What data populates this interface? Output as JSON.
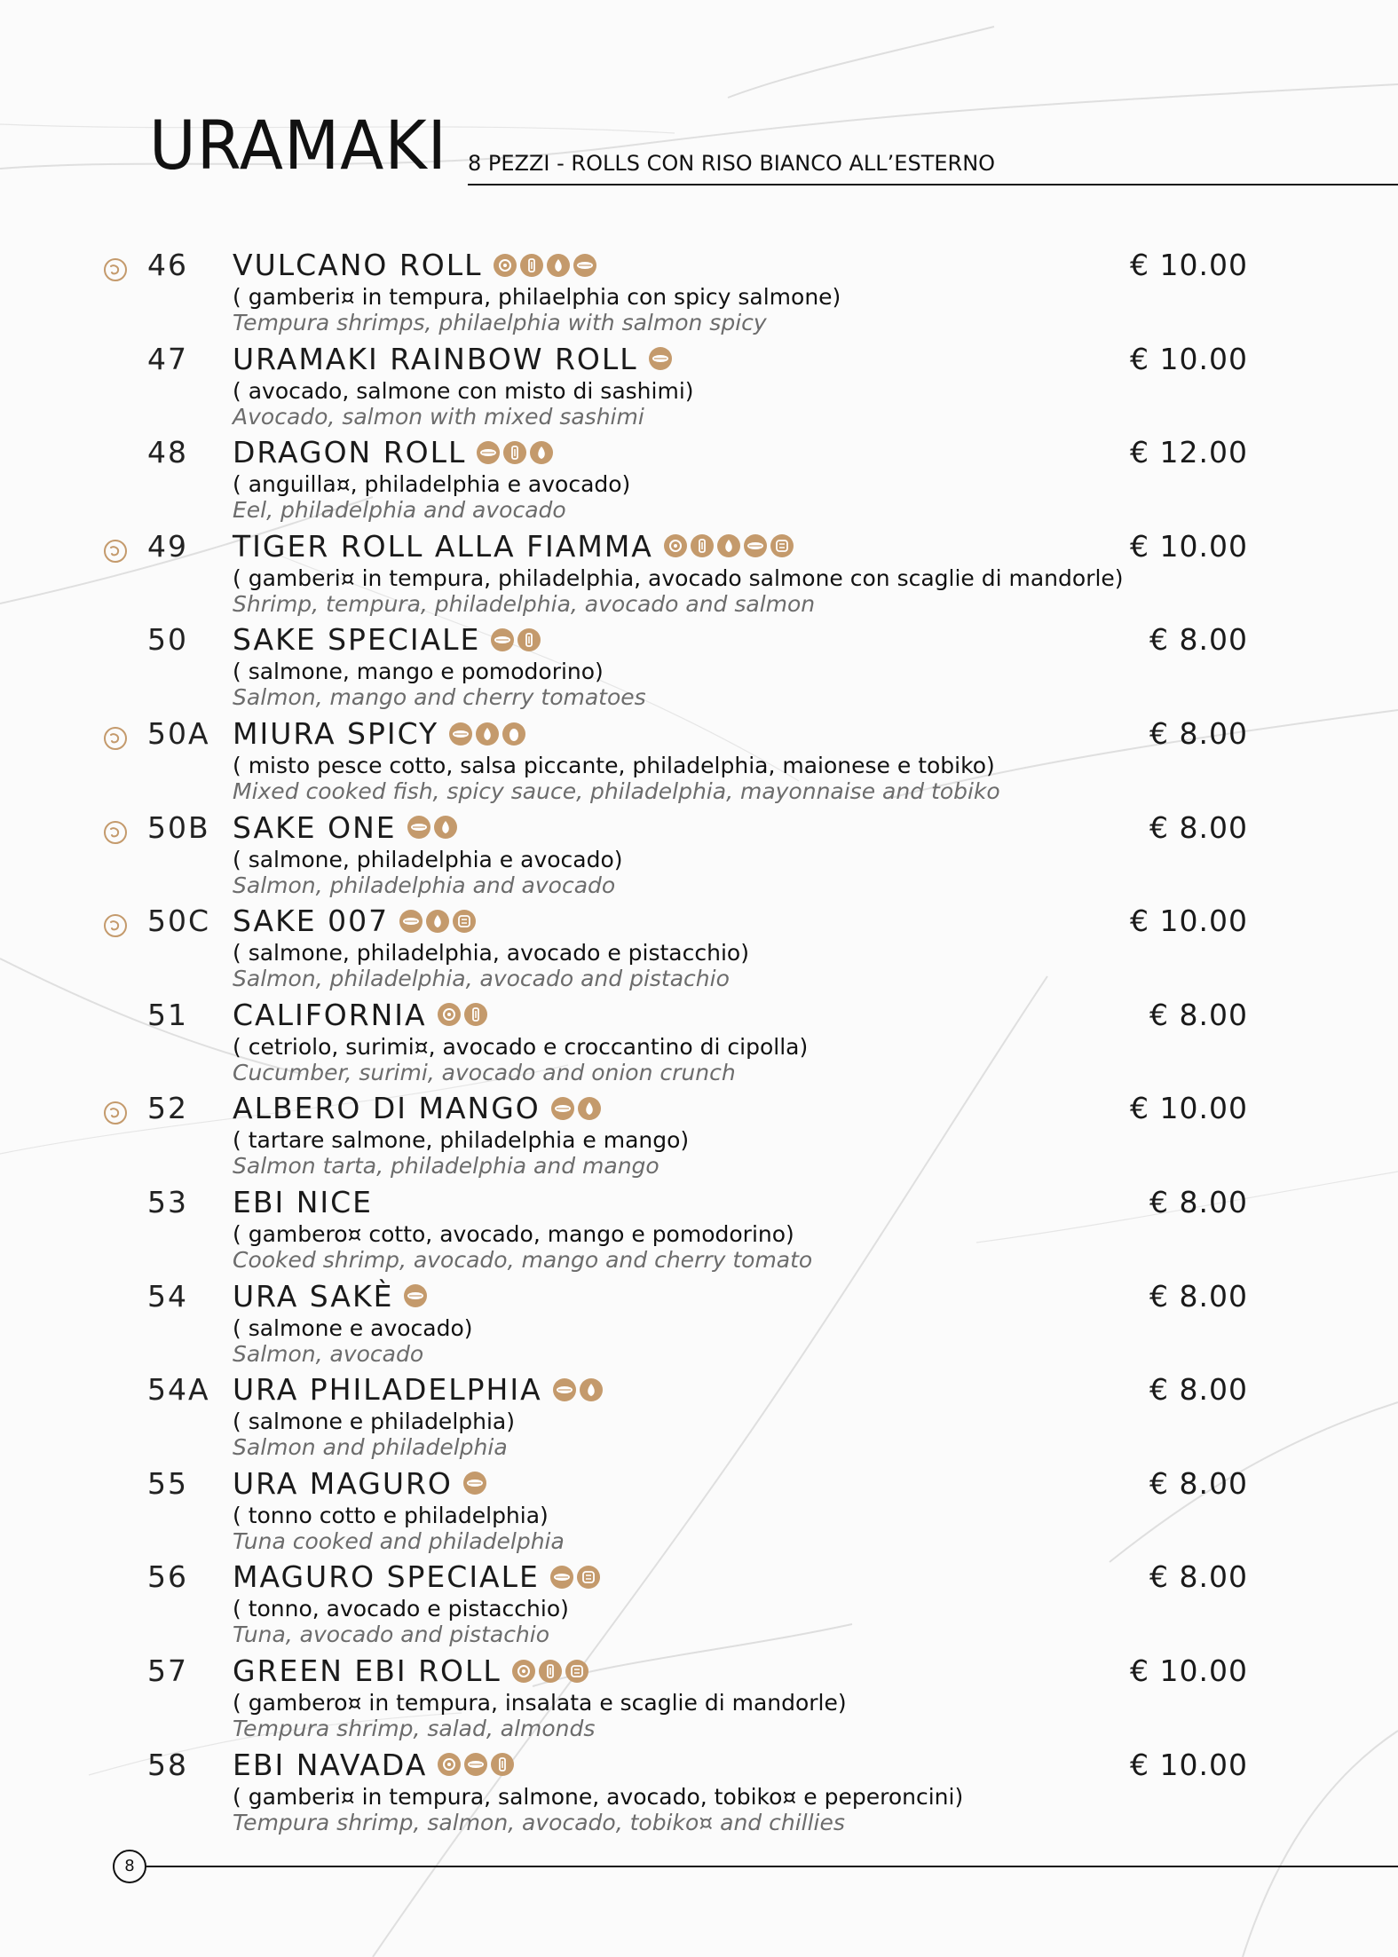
{
  "header": {
    "title": "URAMAKI",
    "subtitle": "8 PEZZI - ROLLS CON RISO BIANCO ALL’ESTERNO"
  },
  "items": [
    {
      "number": "46",
      "name": "VULCANO ROLL",
      "icons": [
        "tempura-icon",
        "fried-icon",
        "philadelphia-icon",
        "salmon-icon"
      ],
      "price": "€ 10.00",
      "desc_it": "( gamberi¤ in tempura, philaelphia con spicy salmone)",
      "desc_en": "Tempura shrimps, philaelphia with salmon spicy",
      "spicy": true
    },
    {
      "number": "47",
      "name": "URAMAKI RAINBOW ROLL",
      "icons": [
        "salmon-icon"
      ],
      "price": "€ 10.00",
      "desc_it": "( avocado, salmone con misto di sashimi)",
      "desc_en": "Avocado, salmon with mixed sashimi",
      "spicy": false
    },
    {
      "number": "48",
      "name": "DRAGON ROLL",
      "icons": [
        "salmon-icon",
        "fried-icon",
        "philadelphia-icon"
      ],
      "price": "€ 12.00",
      "desc_it": "( anguilla¤, philadelphia e avocado)",
      "desc_en": "Eel, philadelphia and avocado",
      "spicy": false
    },
    {
      "number": "49",
      "name": "TIGER ROLL ALLA FIAMMA",
      "icons": [
        "tempura-icon",
        "fried-icon",
        "philadelphia-icon",
        "salmon-icon",
        "nut-icon"
      ],
      "price": "€ 10.00",
      "desc_it": "( gamberi¤ in tempura, philadelphia, avocado salmone con scaglie di mandorle)",
      "desc_en": "Shrimp, tempura, philadelphia, avocado and salmon",
      "spicy": true
    },
    {
      "number": "50",
      "name": "SAKE SPECIALE",
      "icons": [
        "salmon-icon",
        "fried-icon"
      ],
      "price": "€ 8.00",
      "desc_it": "( salmone, mango e pomodorino)",
      "desc_en": "Salmon, mango and cherry tomatoes",
      "spicy": false
    },
    {
      "number": "50A",
      "name": "MIURA SPICY",
      "icons": [
        "salmon-icon",
        "philadelphia-icon",
        "egg-icon"
      ],
      "price": "€ 8.00",
      "desc_it": "( misto pesce cotto, salsa piccante, philadelphia, maionese e tobiko)",
      "desc_en": "Mixed cooked fish, spicy sauce, philadelphia, mayonnaise and tobiko",
      "spicy": true
    },
    {
      "number": "50B",
      "name": "SAKE ONE",
      "icons": [
        "salmon-icon",
        "philadelphia-icon"
      ],
      "price": "€ 8.00",
      "desc_it": "( salmone, philadelphia e avocado)",
      "desc_en": "Salmon, philadelphia and avocado",
      "spicy": true
    },
    {
      "number": "50C",
      "name": "SAKE 007",
      "icons": [
        "salmon-icon",
        "philadelphia-icon",
        "nut-icon"
      ],
      "price": "€ 10.00",
      "desc_it": "( salmone, philadelphia, avocado e pistacchio)",
      "desc_en": "Salmon, philadelphia, avocado and pistachio",
      "spicy": true
    },
    {
      "number": "51",
      "name": "CALIFORNIA",
      "icons": [
        "tempura-icon",
        "fried-icon"
      ],
      "price": "€ 8.00",
      "desc_it": "( cetriolo, surimi¤, avocado e croccantino di cipolla)",
      "desc_en": "Cucumber, surimi, avocado and onion crunch",
      "spicy": false
    },
    {
      "number": "52",
      "name": "ALBERO DI MANGO",
      "icons": [
        "salmon-icon",
        "philadelphia-icon"
      ],
      "price": "€ 10.00",
      "desc_it": "( tartare salmone, philadelphia e mango)",
      "desc_en": "Salmon tarta, philadelphia and mango",
      "spicy": true
    },
    {
      "number": "53",
      "name": "EBI NICE",
      "icons": [],
      "price": "€ 8.00",
      "desc_it": "( gambero¤ cotto, avocado, mango e pomodorino)",
      "desc_en": "Cooked shrimp, avocado, mango and cherry tomato",
      "spicy": false
    },
    {
      "number": "54",
      "name": "URA SAKÈ",
      "icons": [
        "salmon-icon"
      ],
      "price": "€ 8.00",
      "desc_it": "( salmone e avocado)",
      "desc_en": "Salmon, avocado",
      "spicy": false
    },
    {
      "number": "54A",
      "name": "URA PHILADELPHIA",
      "icons": [
        "salmon-icon",
        "philadelphia-icon"
      ],
      "price": "€ 8.00",
      "desc_it": "( salmone e philadelphia)",
      "desc_en": "Salmon and philadelphia",
      "spicy": false
    },
    {
      "number": "55",
      "name": "URA MAGURO",
      "icons": [
        "salmon-icon"
      ],
      "price": "€ 8.00",
      "desc_it": "( tonno cotto e philadelphia)",
      "desc_en": "Tuna cooked and philadelphia",
      "spicy": false
    },
    {
      "number": "56",
      "name": "MAGURO SPECIALE",
      "icons": [
        "salmon-icon",
        "nut-icon"
      ],
      "price": "€ 8.00",
      "desc_it": "( tonno, avocado e pistacchio)",
      "desc_en": "Tuna, avocado and pistachio",
      "spicy": false
    },
    {
      "number": "57",
      "name": "GREEN EBI ROLL",
      "icons": [
        "tempura-icon",
        "fried-icon",
        "nut-icon"
      ],
      "price": "€ 10.00",
      "desc_it": "( gambero¤ in tempura, insalata e scaglie di mandorle)",
      "desc_en": "Tempura shrimp, salad, almonds",
      "spicy": false
    },
    {
      "number": "58",
      "name": "EBI NAVADA",
      "icons": [
        "tempura-icon",
        "salmon-icon",
        "fried-icon"
      ],
      "price": "€ 10.00",
      "desc_it": "( gamberi¤ in tempura, salmone, avocado, tobiko¤ e peperoncini)",
      "desc_en": "Tempura shrimp, salmon, avocado, tobiko¤ and chillies",
      "spicy": false
    }
  ],
  "footer": {
    "page_number": "8"
  },
  "colors": {
    "accent": "#c49a6c",
    "text": "#111111",
    "english_text": "#6c6c6c"
  }
}
